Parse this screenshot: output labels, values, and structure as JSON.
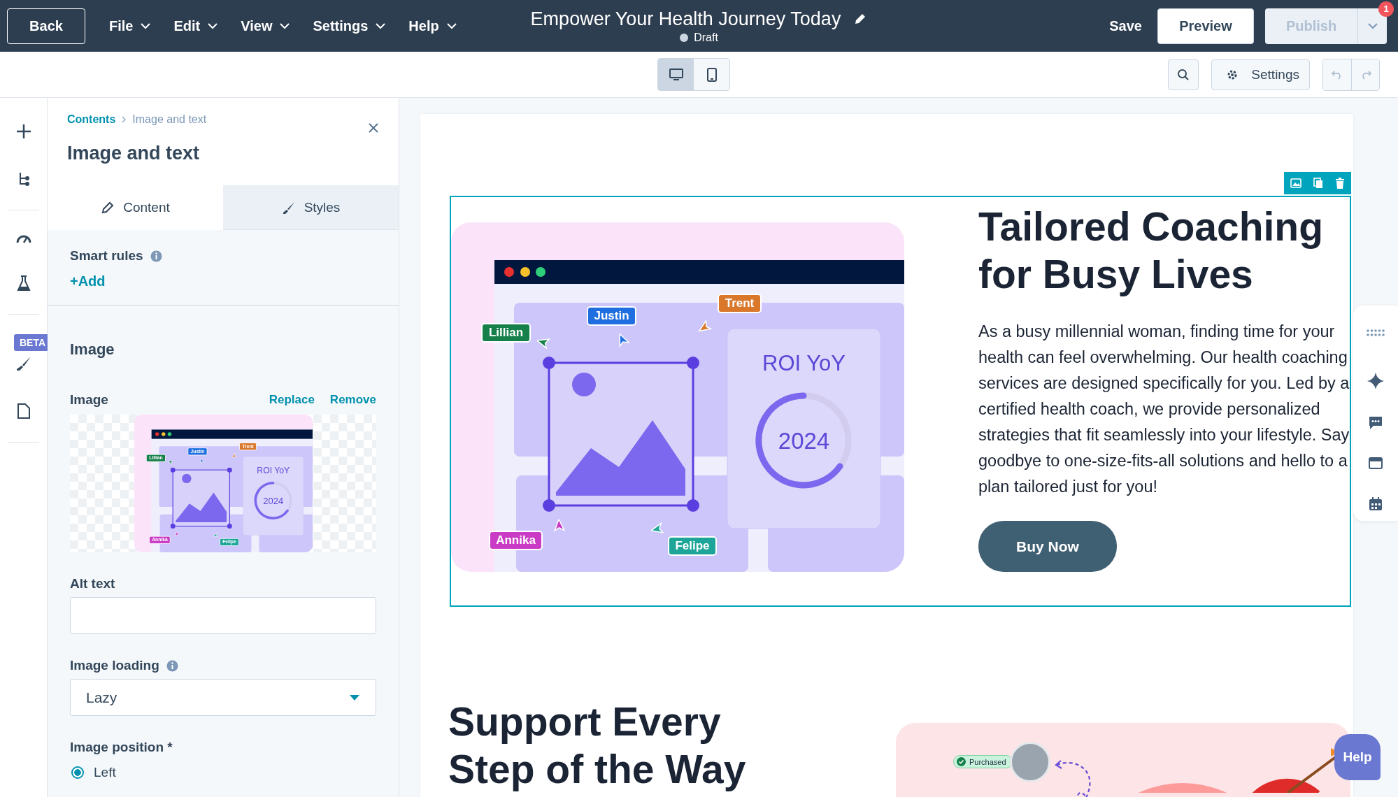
{
  "topbar": {
    "back": "Back",
    "menus": [
      {
        "label": "File"
      },
      {
        "label": "Edit"
      },
      {
        "label": "View"
      },
      {
        "label": "Settings"
      },
      {
        "label": "Help"
      }
    ],
    "title": "Empower Your Health Journey Today",
    "status": "Draft",
    "save": "Save",
    "preview": "Preview",
    "publish": {
      "label": "Publish",
      "disabled": true
    },
    "notification_count": "1"
  },
  "toolbar": {
    "devices": [
      {
        "kind": "desktop",
        "selected": true
      },
      {
        "kind": "mobile",
        "selected": false
      }
    ],
    "settings": "Settings"
  },
  "rail": {
    "beta_badge": "BETA"
  },
  "panel": {
    "breadcrumb": [
      "Contents",
      "Image and text"
    ],
    "title": "Image and text",
    "tabs": [
      {
        "label": "Content",
        "kind": "pencil",
        "selected": true
      },
      {
        "label": "Styles",
        "kind": "brush",
        "selected": false
      }
    ],
    "smart_rules": "Smart rules",
    "add": "+Add",
    "section": "Image",
    "image_label": "Image",
    "replace": "Replace",
    "remove": "Remove",
    "preview": {
      "tags": [
        {
          "label": "Lillian",
          "color": "#16804a"
        },
        {
          "label": "Justin",
          "color": "#1f6fe0"
        },
        {
          "label": "Trent",
          "color": "#d9772a"
        },
        {
          "label": "Annika",
          "color": "#c93bc4"
        },
        {
          "label": "Felipe",
          "color": "#1ea59a"
        }
      ],
      "card_title": "ROI YoY",
      "card_year": "2024"
    },
    "alt_label": "Alt text",
    "loading_label": "Image loading",
    "loading_value": "Lazy",
    "position_label": "Image position *",
    "positions": [
      {
        "label": "Left",
        "selected": true
      }
    ]
  },
  "canvas": {
    "section": {
      "illustration": {
        "tags": [
          {
            "label": "Lillian",
            "color": "#16804a"
          },
          {
            "label": "Justin",
            "color": "#1f6fe0"
          },
          {
            "label": "Trent",
            "color": "#d9772a"
          },
          {
            "label": "Annika",
            "color": "#c93bc4"
          },
          {
            "label": "Felipe",
            "color": "#1ea59a"
          }
        ],
        "card_title": "ROI YoY",
        "card_year": "2024"
      },
      "heading": "Tailored Coaching for Busy Lives",
      "body": "As a busy millennial woman, finding time for your health can feel overwhelming. Our health coaching services are designed specifically for you. Led by a certified health coach, we provide personalized strategies that fit seamlessly into your lifestyle. Say goodbye to one-size-fits-all solutions and hello to a plan tailored just for you!",
      "button": "Buy Now"
    },
    "next_section": {
      "heading": "Support Every Step of the Way",
      "badge": "Purchased"
    },
    "help": "Help"
  }
}
